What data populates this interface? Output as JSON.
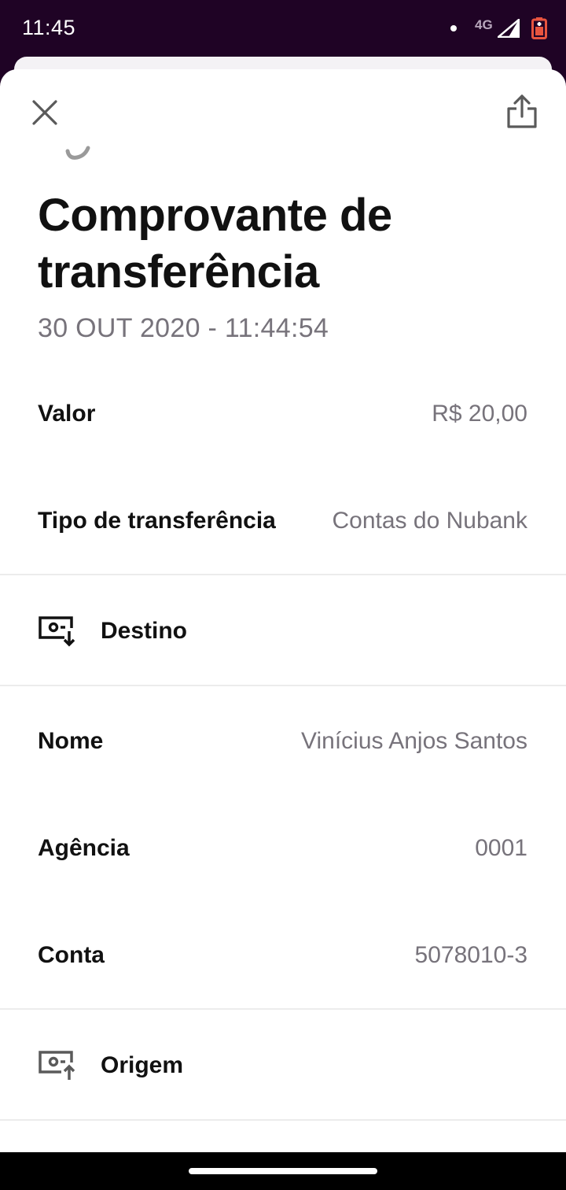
{
  "status_bar": {
    "time": "11:45",
    "network": "4G",
    "icons": [
      "notification-dot-icon",
      "signal-icon",
      "battery-icon"
    ],
    "battery_color": "#e8543f"
  },
  "header": {
    "close_icon": "close-icon",
    "share_icon": "share-icon"
  },
  "receipt": {
    "title": "Comprovante de transferência",
    "date": "30 OUT 2020 - 11:44:54",
    "rows": [
      {
        "label": "Valor",
        "value": "R$ 20,00"
      },
      {
        "label": "Tipo de transferência",
        "value": "Contas do Nubank"
      }
    ]
  },
  "destino": {
    "label": "Destino",
    "icon": "account-incoming-icon",
    "rows": [
      {
        "label": "Nome",
        "value": "Vinícius Anjos Santos"
      },
      {
        "label": "Agência",
        "value": "0001"
      },
      {
        "label": "Conta",
        "value": "5078010-3"
      }
    ]
  },
  "origem": {
    "label": "Origem",
    "icon": "account-outgoing-icon"
  },
  "colors": {
    "brand_dark": "#1f0325",
    "text_primary": "#111111",
    "text_secondary": "#77737b",
    "divider": "#ececec"
  }
}
